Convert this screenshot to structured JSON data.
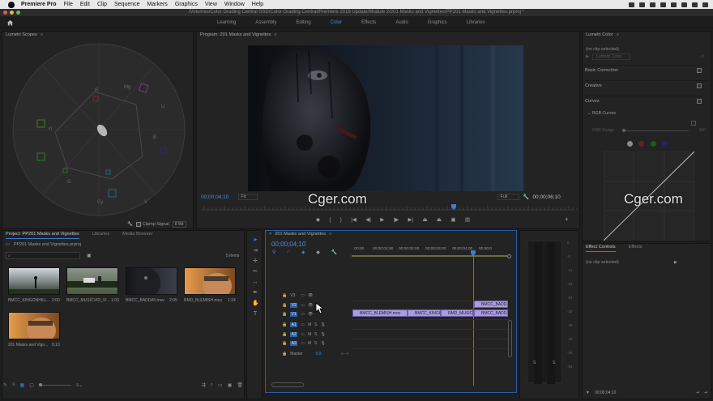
{
  "menubar": {
    "app": "Premiere Pro",
    "items": [
      "File",
      "Edit",
      "Clip",
      "Sequence",
      "Markers",
      "Graphics",
      "View",
      "Window",
      "Help"
    ]
  },
  "titlebar": {
    "path": "/Volumes/Color Grading Central SSD/Color Grading Central/Premiere 2019 Update/Module 2/201 Masks and Vignettes/PP201 Masks and Vignettes.prproj *"
  },
  "workspace": {
    "tabs": [
      "Learning",
      "Assembly",
      "Editing",
      "Color",
      "Effects",
      "Audio",
      "Graphics",
      "Libraries"
    ],
    "active": "Color"
  },
  "scopes": {
    "title": "Lumetri Scopes",
    "vector_labels": [
      "R",
      "Mg",
      "B",
      "Cy",
      "G",
      "Yl",
      "U",
      "V"
    ],
    "clamp_label": "Clamp Signal",
    "bit_depth": "8 Bit"
  },
  "program": {
    "title": "Program: 201 Masks and Vignettes",
    "timecode_current": "00;00;04;10",
    "fit": "Fit",
    "quality": "Full",
    "timecode_duration": "00;00;06;10"
  },
  "lumetri": {
    "title": "Lumetri Color",
    "no_clip": "(no clip selected)",
    "dropdown": "Lumetri Color",
    "sections": [
      "Basic Correction",
      "Creative",
      "Curves"
    ],
    "rgb_curves": "RGB Curves",
    "hdr_range": "HDR Range",
    "hdr_value": "100"
  },
  "project": {
    "tabs": [
      "Project: PP201 Masks and Vignettes",
      "Libraries",
      "Media Browser"
    ],
    "filename": "PP201 Masks and Vignettes.prproj",
    "item_count": "5 Items",
    "items": [
      {
        "name": "BMCC_KINGONHILL...",
        "dur": "2:00"
      },
      {
        "name": "BMCC_MUSICVID_VI...",
        "dur": "1:03"
      },
      {
        "name": "BMCC_BADDAY.mov",
        "dur": "2:05"
      },
      {
        "name": "RMD_BLEMISH.mov",
        "dur": "1:24"
      },
      {
        "name": "201 Masks and Vign...",
        "dur": "6;10"
      }
    ]
  },
  "timeline": {
    "title": "201 Masks and Vignettes",
    "timecode": "00;00;04;10",
    "ruler": [
      ";00;00",
      "00;00;01;00",
      "00;00;02;00",
      "00;00;03;00",
      "00;00;04;00",
      "00;00;0"
    ],
    "video_tracks": [
      "V3",
      "V2",
      "V1"
    ],
    "audio_tracks": [
      "A1",
      "A2",
      "A3"
    ],
    "master_label": "Master",
    "master_value": "0.0",
    "clips_v1": [
      "BMCC_BLEMISH.mov",
      "BMCC_KINGO",
      "RMD_MUSIC",
      "BMCC_BADDA"
    ],
    "clip_v2": "BMCC_BADDA"
  },
  "effects": {
    "tabs": [
      "Effect Controls",
      "Effects"
    ],
    "no_clip": "(no clip selected)",
    "timecode": "00;00;04;10"
  },
  "meters": {
    "scale": [
      "0",
      "-6",
      "-12",
      "-18",
      "-24",
      "-30",
      "-36",
      "-42",
      "-48",
      "-54"
    ],
    "bottom": [
      "S",
      "S"
    ]
  },
  "watermark": "Cger.com"
}
